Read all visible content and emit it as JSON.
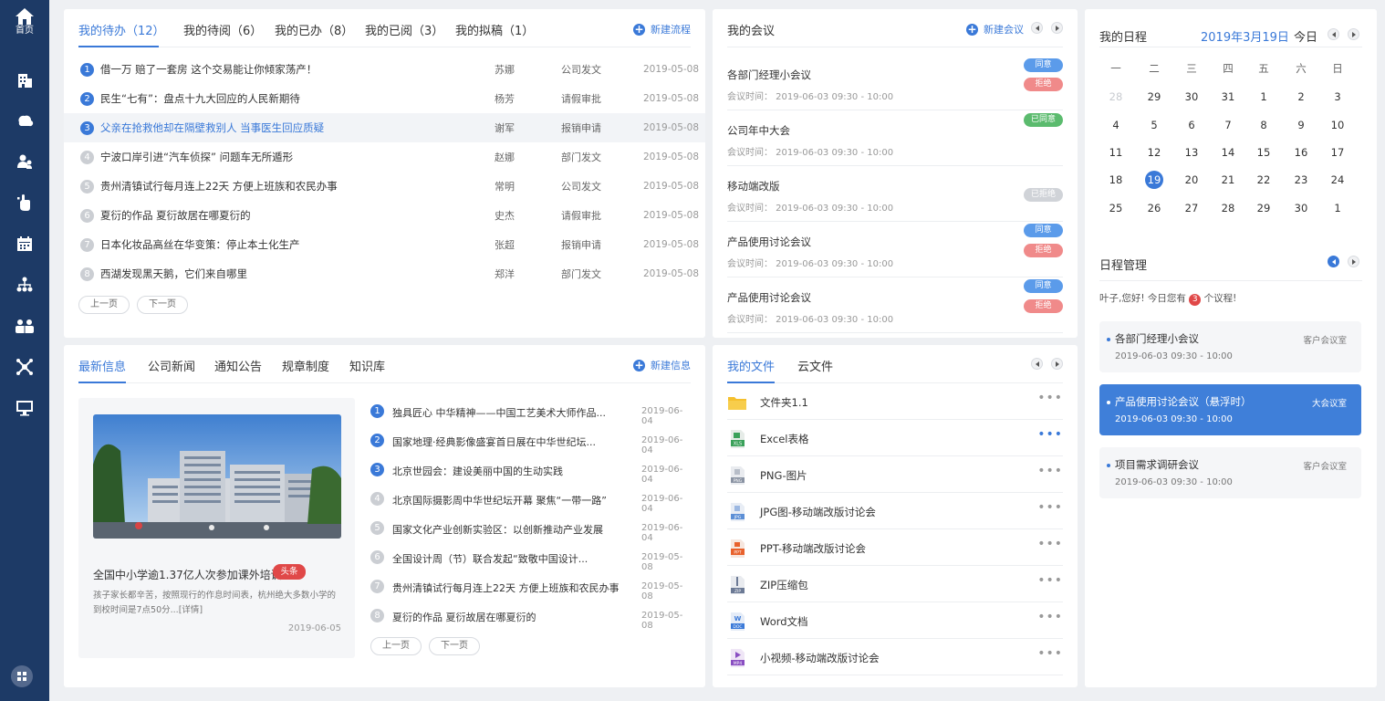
{
  "sidebar": {
    "home_label": "首页",
    "icons": [
      "building-icon",
      "cloud-icon",
      "users-icon",
      "hand-pointer-icon",
      "calendar-icon",
      "org-chart-icon",
      "team-icon",
      "network-icon",
      "monitor-icon"
    ],
    "bottom_icon": "apps-grid-icon"
  },
  "todo": {
    "tabs": [
      {
        "label": "我的待办（12）",
        "active": true
      },
      {
        "label": "我的待阅（6）",
        "active": false
      },
      {
        "label": "我的已办（8）",
        "active": false
      },
      {
        "label": "我的已阅（3）",
        "active": false
      },
      {
        "label": "我的拟稿（1）",
        "active": false
      }
    ],
    "action_label": "新建流程",
    "rows": [
      {
        "num": "1",
        "title": "借一万 赔了一套房 这个交易能让你倾家荡产！",
        "person": "苏娜",
        "type": "公司发文",
        "date": "2019-05-08"
      },
      {
        "num": "2",
        "title": "民生“七有”：盘点十九大回应的人民新期待",
        "person": "杨芳",
        "type": "请假审批",
        "date": "2019-05-08"
      },
      {
        "num": "3",
        "title": "父亲在抢救他却在隔壁救别人 当事医生回应质疑",
        "person": "谢军",
        "type": "报销申请",
        "date": "2019-05-08"
      },
      {
        "num": "4",
        "title": "宁波口岸引进“汽车侦探” 问题车无所遁形",
        "person": "赵娜",
        "type": "部门发文",
        "date": "2019-05-08"
      },
      {
        "num": "5",
        "title": "贵州清镇试行每月连上22天 方便上班族和农民办事",
        "person": "常明",
        "type": "公司发文",
        "date": "2019-05-08"
      },
      {
        "num": "6",
        "title": "夏衍的作品 夏衍故居在哪夏衍的",
        "person": "史杰",
        "type": "请假审批",
        "date": "2019-05-08"
      },
      {
        "num": "7",
        "title": "日本化妆品高丝在华变策：停止本土化生产",
        "person": "张超",
        "type": "报销申请",
        "date": "2019-05-08"
      },
      {
        "num": "8",
        "title": "西湖发现黑天鹅，它们来自哪里",
        "person": "郑洋",
        "type": "部门发文",
        "date": "2019-05-08"
      }
    ],
    "prev_label": "上一页",
    "next_label": "下一页"
  },
  "meetings": {
    "title": "我的会议",
    "action_label": "新建会议",
    "items": [
      {
        "title": "各部门经理小会议",
        "time": "会议时间： 2019-06-03   09:30 - 10:00",
        "badges": [
          {
            "label": "同意",
            "color": "#5b9bea"
          },
          {
            "label": "拒绝",
            "color": "#f08a8a"
          }
        ]
      },
      {
        "title": "公司年中大会",
        "time": "会议时间： 2019-06-03   09:30 - 10:00",
        "badges": [
          {
            "label": "已同意",
            "color": "#5bbb6e"
          }
        ]
      },
      {
        "title": "移动端改版",
        "time": "会议时间： 2019-06-03   09:30 - 10:00",
        "badges": [
          {
            "label": "已拒绝",
            "color": "#d0d3d8"
          }
        ]
      },
      {
        "title": "产品使用讨论会议",
        "time": "会议时间： 2019-06-03   09:30 - 10:00",
        "badges": [
          {
            "label": "同意",
            "color": "#5b9bea"
          },
          {
            "label": "拒绝",
            "color": "#f08a8a"
          }
        ]
      },
      {
        "title": "产品使用讨论会议",
        "time": "会议时间： 2019-06-03   09:30 - 10:00",
        "badges": [
          {
            "label": "同意",
            "color": "#5b9bea"
          },
          {
            "label": "拒绝",
            "color": "#f08a8a"
          }
        ]
      }
    ]
  },
  "calendar": {
    "title": "我的日程",
    "current": "2019年3月19日",
    "today_label": "今日",
    "weekdays": [
      "一",
      "二",
      "三",
      "四",
      "五",
      "六",
      "日"
    ],
    "weeks": [
      [
        {
          "d": "28",
          "dim": true
        },
        {
          "d": "29"
        },
        {
          "d": "30"
        },
        {
          "d": "31"
        },
        {
          "d": "1"
        },
        {
          "d": "2"
        },
        {
          "d": "3"
        }
      ],
      [
        {
          "d": "4"
        },
        {
          "d": "5"
        },
        {
          "d": "6"
        },
        {
          "d": "7"
        },
        {
          "d": "8"
        },
        {
          "d": "9"
        },
        {
          "d": "10"
        }
      ],
      [
        {
          "d": "11"
        },
        {
          "d": "12"
        },
        {
          "d": "13"
        },
        {
          "d": "14"
        },
        {
          "d": "15"
        },
        {
          "d": "16"
        },
        {
          "d": "17"
        }
      ],
      [
        {
          "d": "18"
        },
        {
          "d": "19",
          "today": true
        },
        {
          "d": "20"
        },
        {
          "d": "21"
        },
        {
          "d": "22"
        },
        {
          "d": "23"
        },
        {
          "d": "24"
        }
      ],
      [
        {
          "d": "25"
        },
        {
          "d": "26"
        },
        {
          "d": "27"
        },
        {
          "d": "28"
        },
        {
          "d": "29"
        },
        {
          "d": "30"
        },
        {
          "d": "1"
        }
      ]
    ]
  },
  "schedule": {
    "title": "日程管理",
    "greeting_prefix": "叶子,您好! 今日您有",
    "count": "3",
    "greeting_suffix": "个议程!",
    "items": [
      {
        "title": "各部门经理小会议",
        "time": "2019-06-03   09:30 - 10:00",
        "room": "客户会议室",
        "active": false
      },
      {
        "title": "产品使用讨论会议（悬浮时）",
        "time": "2019-06-03   09:30 - 10:00",
        "room": "大会议室",
        "active": true
      },
      {
        "title": "项目需求调研会议",
        "time": "2019-06-03   09:30 - 10:00",
        "room": "客户会议室",
        "active": false
      }
    ]
  },
  "news": {
    "tabs": [
      {
        "label": "最新信息",
        "active": true
      },
      {
        "label": "公司新闻",
        "active": false
      },
      {
        "label": "通知公告",
        "active": false
      },
      {
        "label": "规章制度",
        "active": false
      },
      {
        "label": "知识库",
        "active": false
      }
    ],
    "action_label": "新建信息",
    "feature": {
      "title": "全国中小学逾1.37亿人次参加课外培训",
      "tag": "头条",
      "desc": "孩子家长都辛苦，按照现行的作息时间表，杭州绝大多数小学的到校时间是7点50分...[详情]",
      "date": "2019-06-05"
    },
    "rows": [
      {
        "num": "1",
        "title": "独具匠心 中华精神——中国工艺美术大师作品...",
        "date": "2019-06-04"
      },
      {
        "num": "2",
        "title": "国家地理·经典影像盛宴首日展在中华世纪坛...",
        "date": "2019-06-04"
      },
      {
        "num": "3",
        "title": "北京世园会：建设美丽中国的生动实践",
        "date": "2019-06-04"
      },
      {
        "num": "4",
        "title": "北京国际摄影周中华世纪坛开幕 聚焦“一带一路”",
        "date": "2019-06-04"
      },
      {
        "num": "5",
        "title": "国家文化产业创新实验区：以创新推动产业发展",
        "date": "2019-06-04"
      },
      {
        "num": "6",
        "title": "全国设计周（节）联合发起“致敬中国设计...",
        "date": "2019-05-08"
      },
      {
        "num": "7",
        "title": "贵州清镇试行每月连上22天 方便上班族和农民办事",
        "date": "2019-05-08"
      },
      {
        "num": "8",
        "title": "夏衍的作品 夏衍故居在哪夏衍的",
        "date": "2019-05-08"
      }
    ],
    "prev_label": "上一页",
    "next_label": "下一页"
  },
  "files": {
    "tabs": [
      {
        "label": "我的文件",
        "active": true
      },
      {
        "label": "云文件",
        "active": false
      }
    ],
    "items": [
      {
        "name": "文件夹1.1",
        "icon": "folder-icon",
        "color": "#f5c02e",
        "ext": ""
      },
      {
        "name": "Excel表格",
        "icon": "excel-file-icon",
        "color": "#3aa15a",
        "ext": "XLS"
      },
      {
        "name": "PNG-图片",
        "icon": "png-file-icon",
        "color": "#8a93a3",
        "ext": "PNG"
      },
      {
        "name": "JPG图-移动端改版讨论会",
        "icon": "jpg-file-icon",
        "color": "#5c8fd6",
        "ext": "JPG"
      },
      {
        "name": "PPT-移动端改版讨论会",
        "icon": "ppt-file-icon",
        "color": "#e8612c",
        "ext": "PPT"
      },
      {
        "name": "ZIP压缩包",
        "icon": "zip-file-icon",
        "color": "#6c7a95",
        "ext": "ZIP"
      },
      {
        "name": "Word文档",
        "icon": "word-file-icon",
        "color": "#3a79d8",
        "ext": "DOC"
      },
      {
        "name": "小视频-移动端改版讨论会",
        "icon": "video-file-icon",
        "color": "#8a4fc2",
        "ext": "MP4"
      }
    ],
    "more": "•••"
  }
}
